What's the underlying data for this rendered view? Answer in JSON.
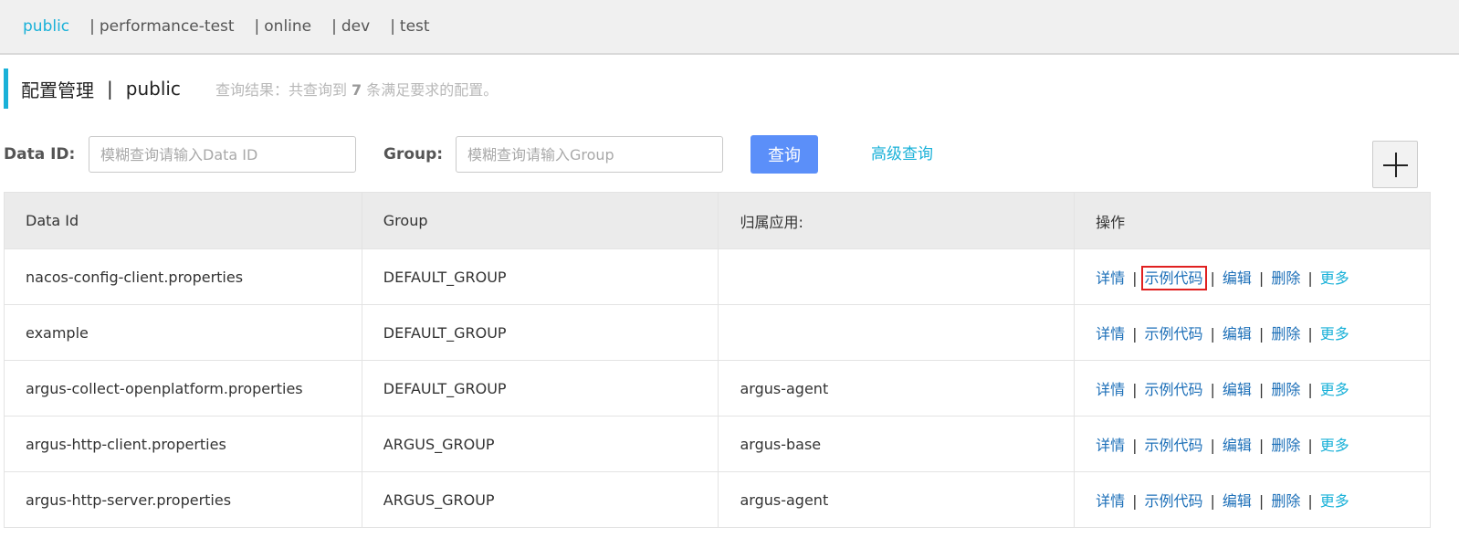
{
  "namespaces": {
    "items": [
      {
        "label": "public",
        "active": true
      },
      {
        "label": "performance-test",
        "active": false
      },
      {
        "label": "online",
        "active": false
      },
      {
        "label": "dev",
        "active": false
      },
      {
        "label": "test",
        "active": false
      }
    ],
    "separator": "|"
  },
  "header": {
    "title": "配置管理",
    "separator": "|",
    "namespace": "public",
    "query_prefix": "查询结果：共查询到 ",
    "query_count": "7",
    "query_suffix": " 条满足要求的配置。"
  },
  "search": {
    "data_id_label": "Data ID:",
    "data_id_placeholder": "模糊查询请输入Data ID",
    "group_label": "Group:",
    "group_placeholder": "模糊查询请输入Group",
    "query_button": "查询",
    "advanced_link": "高级查询",
    "add_icon": "plus-icon"
  },
  "table": {
    "columns": [
      "Data Id",
      "Group",
      "归属应用:",
      "操作"
    ],
    "rows": [
      {
        "data_id": "nacos-config-client.properties",
        "group": "DEFAULT_GROUP",
        "app": ""
      },
      {
        "data_id": "example",
        "group": "DEFAULT_GROUP",
        "app": ""
      },
      {
        "data_id": "argus-collect-openplatform.properties",
        "group": "DEFAULT_GROUP",
        "app": "argus-agent"
      },
      {
        "data_id": "argus-http-client.properties",
        "group": "ARGUS_GROUP",
        "app": "argus-base"
      },
      {
        "data_id": "argus-http-server.properties",
        "group": "ARGUS_GROUP",
        "app": "argus-agent"
      }
    ],
    "actions": {
      "detail": "详情",
      "sample_code": "示例代码",
      "edit": "编辑",
      "delete": "删除",
      "more": "更多",
      "separator": "|"
    }
  },
  "colors": {
    "accent": "#1ab1d8",
    "primary_button": "#5b8ff9",
    "link": "#1c6fb8",
    "highlight_box": "#e02020"
  }
}
